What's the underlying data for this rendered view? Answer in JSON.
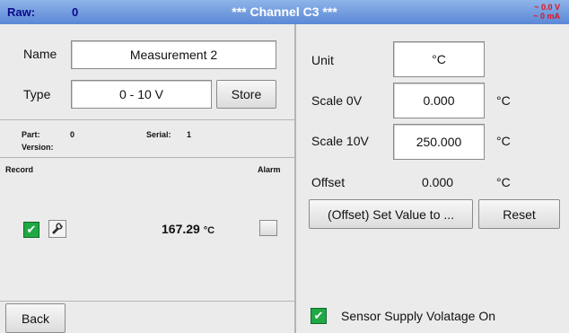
{
  "titlebar": {
    "raw_label": "Raw:",
    "raw_value": "0",
    "title": "*** Channel C3 ***",
    "voltage": "~ 0.0 V",
    "current": "~ 0 mA"
  },
  "left": {
    "name_label": "Name",
    "name_value": "Measurement 2",
    "type_label": "Type",
    "type_value": "0 - 10 V",
    "store_button": "Store",
    "part_label": "Part:",
    "part_value": "0",
    "serial_label": "Serial:",
    "serial_value": "1",
    "version_label": "Version:",
    "record_label": "Record",
    "alarm_label": "Alarm",
    "measurement_value": "167.29",
    "measurement_unit": "°C",
    "back_button": "Back"
  },
  "right": {
    "unit_label": "Unit",
    "unit_value": "°C",
    "scale0_label": "Scale 0V",
    "scale0_value": "0.000",
    "scale0_unit": "°C",
    "scale10_label": "Scale 10V",
    "scale10_value": "250.000",
    "scale10_unit": "°C",
    "offset_label": "Offset",
    "offset_value": "0.000",
    "offset_unit": "°C",
    "set_value_button": "(Offset) Set Value to ...",
    "reset_button": "Reset",
    "sensor_supply_label": "Sensor Supply Volatage On",
    "sensor_supply_checked": true
  },
  "colors": {
    "titlebar": "#6b95dd",
    "panel": "#ebebeb",
    "check_green": "#20a845",
    "readout_red": "#e0141e"
  },
  "icons": {
    "record_checkbox": "check-icon",
    "record_settings": "wrench-icon",
    "sensor_supply_checkbox": "check-icon"
  }
}
